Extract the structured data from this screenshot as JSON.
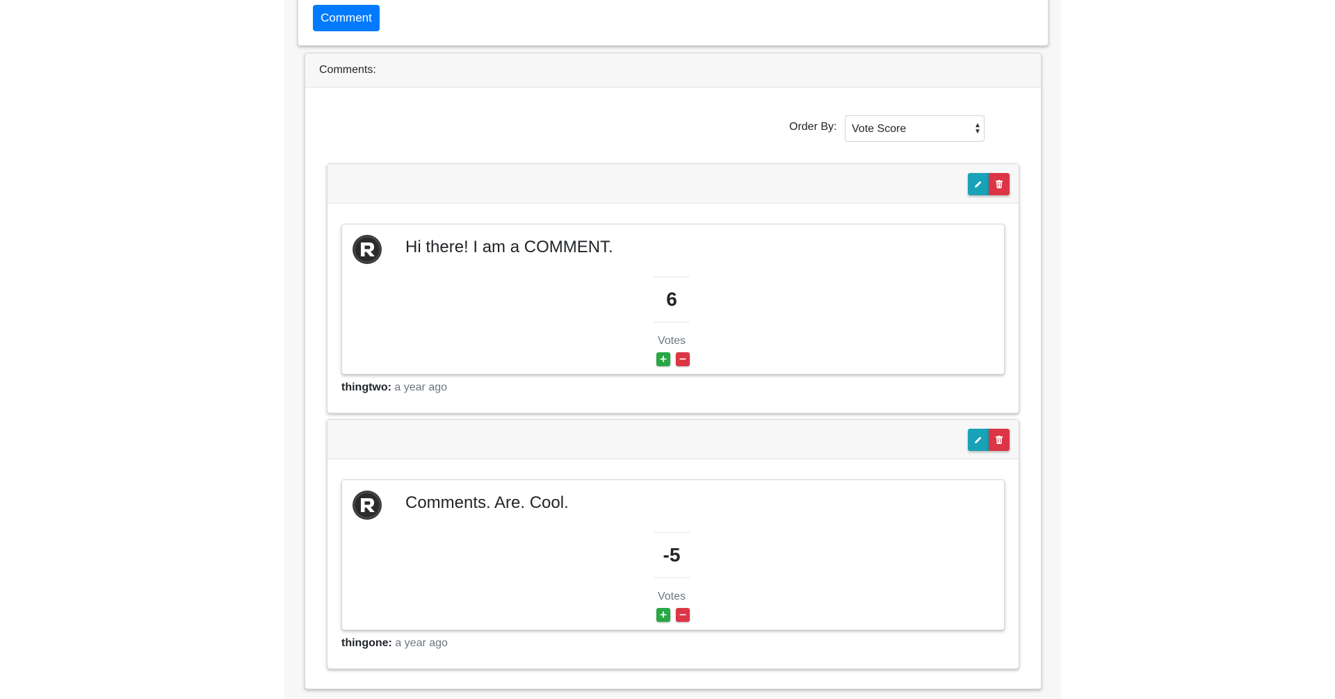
{
  "compose": {
    "comment_button_label": "Comment"
  },
  "comments_section": {
    "header_title": "Comments:",
    "order_by_label": "Order By:",
    "order_by_value": "Vote Score"
  },
  "comments": [
    {
      "text": "Hi there! I am a COMMENT.",
      "score": "6",
      "votes_label": "Votes",
      "upvote_label": "+",
      "downvote_label": "−",
      "author": "thingtwo:",
      "timestamp": "a year ago"
    },
    {
      "text": "Comments. Are. Cool.",
      "score": "-5",
      "votes_label": "Votes",
      "upvote_label": "+",
      "downvote_label": "−",
      "author": "thingone:",
      "timestamp": "a year ago"
    }
  ],
  "icons": {
    "edit": "pencil-icon",
    "delete": "trash-icon",
    "avatar": "redux-logo-icon",
    "select_arrows": "select-arrows-icon"
  },
  "colors": {
    "primary": "#007bff",
    "info": "#17a2b8",
    "danger": "#dc3545",
    "success": "#28a745",
    "muted": "#6c757d"
  }
}
